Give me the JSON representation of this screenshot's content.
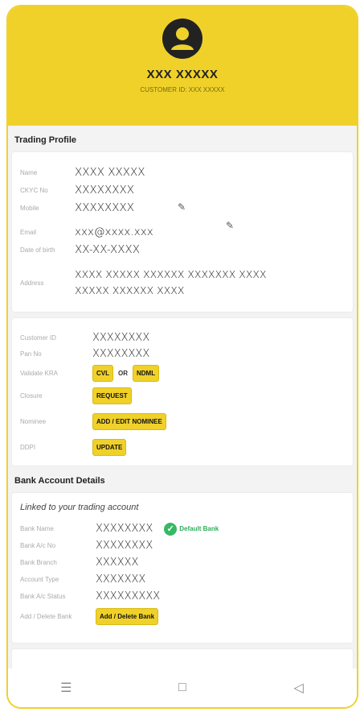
{
  "header": {
    "name": "XXX XXXXX",
    "customer_id_label": "CUSTOMER ID:",
    "customer_id_value": "XXX XXXXX"
  },
  "trading_profile": {
    "title": "Trading Profile",
    "fields": [
      {
        "label": "Name",
        "value": "XXXX XXXXX"
      },
      {
        "label": "CKYC No",
        "value": "XXXXXXXX"
      },
      {
        "label": "Mobile",
        "value": "XXXXXXXX"
      },
      {
        "label": "Email",
        "value": "xxx@xxxx.xxx"
      },
      {
        "label": "Date of birth",
        "value": "XX-XX-XXXX"
      },
      {
        "label": "Address",
        "value": "XXXX XXXXX XXXXXX XXXXXXX XXXX XXXXX XXXXXX XXXX"
      }
    ]
  },
  "account_info": {
    "customer_id_label": "Customer ID",
    "customer_id_value": "XXXXXXXX",
    "pan_label": "Pan No",
    "pan_value": "XXXXXXXX",
    "kra_label": "Validate KRA",
    "cvl": "CVL",
    "or": "OR",
    "ndml": "NDML",
    "closure_label": "Closure",
    "request": "REQUEST",
    "nominee_label": "Nominee",
    "add_edit_nominee": "ADD / EDIT NOMINEE",
    "ddpi_label": "DDPI",
    "update": "UPDATE"
  },
  "bank": {
    "title": "Bank Account Details",
    "linked_text": "Linked to your trading account",
    "bank_name_label": "Bank Name",
    "bank_name_value": "XXXXXXXX",
    "default_bank": "Default Bank",
    "account_no_label": "Bank A/c No",
    "account_no_value": "XXXXXXXX",
    "branch_label": "Bank Branch",
    "branch_value": "XXXXXX",
    "type_label": "Account Type",
    "type_value": "XXXXXXX",
    "status_label": "Bank A/c Status",
    "status_value": "XXXXXXXXX",
    "add_delete_label": "Add / Delete Bank",
    "add_delete_button": "Add / Delete Bank"
  },
  "nav": {
    "icons": [
      "menu-icon",
      "home-square-icon",
      "back-triangle-icon"
    ]
  },
  "colors": {
    "accent": "#f0d12a",
    "success": "#37b864"
  }
}
